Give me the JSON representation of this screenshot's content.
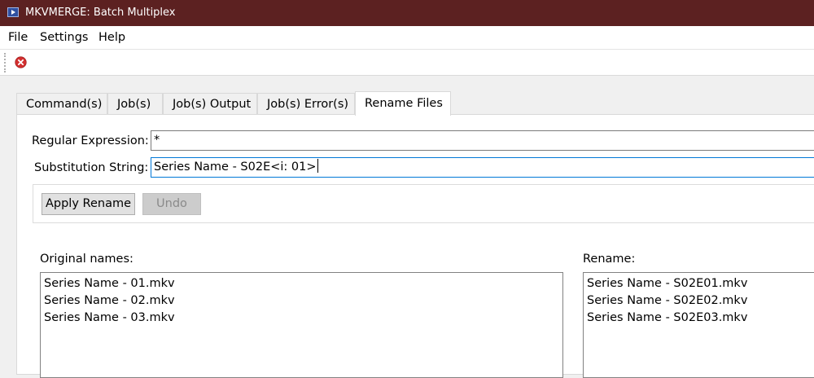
{
  "window": {
    "title": "MKVMERGE: Batch Multiplex"
  },
  "menubar": {
    "items": [
      "File",
      "Settings",
      "Help"
    ]
  },
  "toolbar": {
    "stop_icon": "red-circle-x-icon"
  },
  "tabs": [
    {
      "label": "Command(s)",
      "active": false
    },
    {
      "label": "Job(s)",
      "active": false
    },
    {
      "label": "Job(s) Output",
      "active": false
    },
    {
      "label": "Job(s) Error(s)",
      "active": false
    },
    {
      "label": "Rename Files",
      "active": true
    }
  ],
  "rename": {
    "regex_label": "Regular Expression:",
    "regex_value": "*",
    "subst_label": "Substitution String:",
    "subst_value": "Series Name - S02E<i: 01>",
    "apply_label": "Apply Rename",
    "undo_label": "Undo",
    "original_label": "Original names:",
    "rename_label": "Rename:",
    "original_names": [
      "Series Name - 01.mkv",
      "Series Name - 02.mkv",
      "Series Name - 03.mkv"
    ],
    "renamed_names": [
      "Series Name - S02E01.mkv",
      "Series Name - S02E02.mkv",
      "Series Name - S02E03.mkv"
    ]
  },
  "colors": {
    "titlebar": "#5c2121",
    "focus_border": "#0078d7",
    "stop_icon": "#d32f2f"
  }
}
